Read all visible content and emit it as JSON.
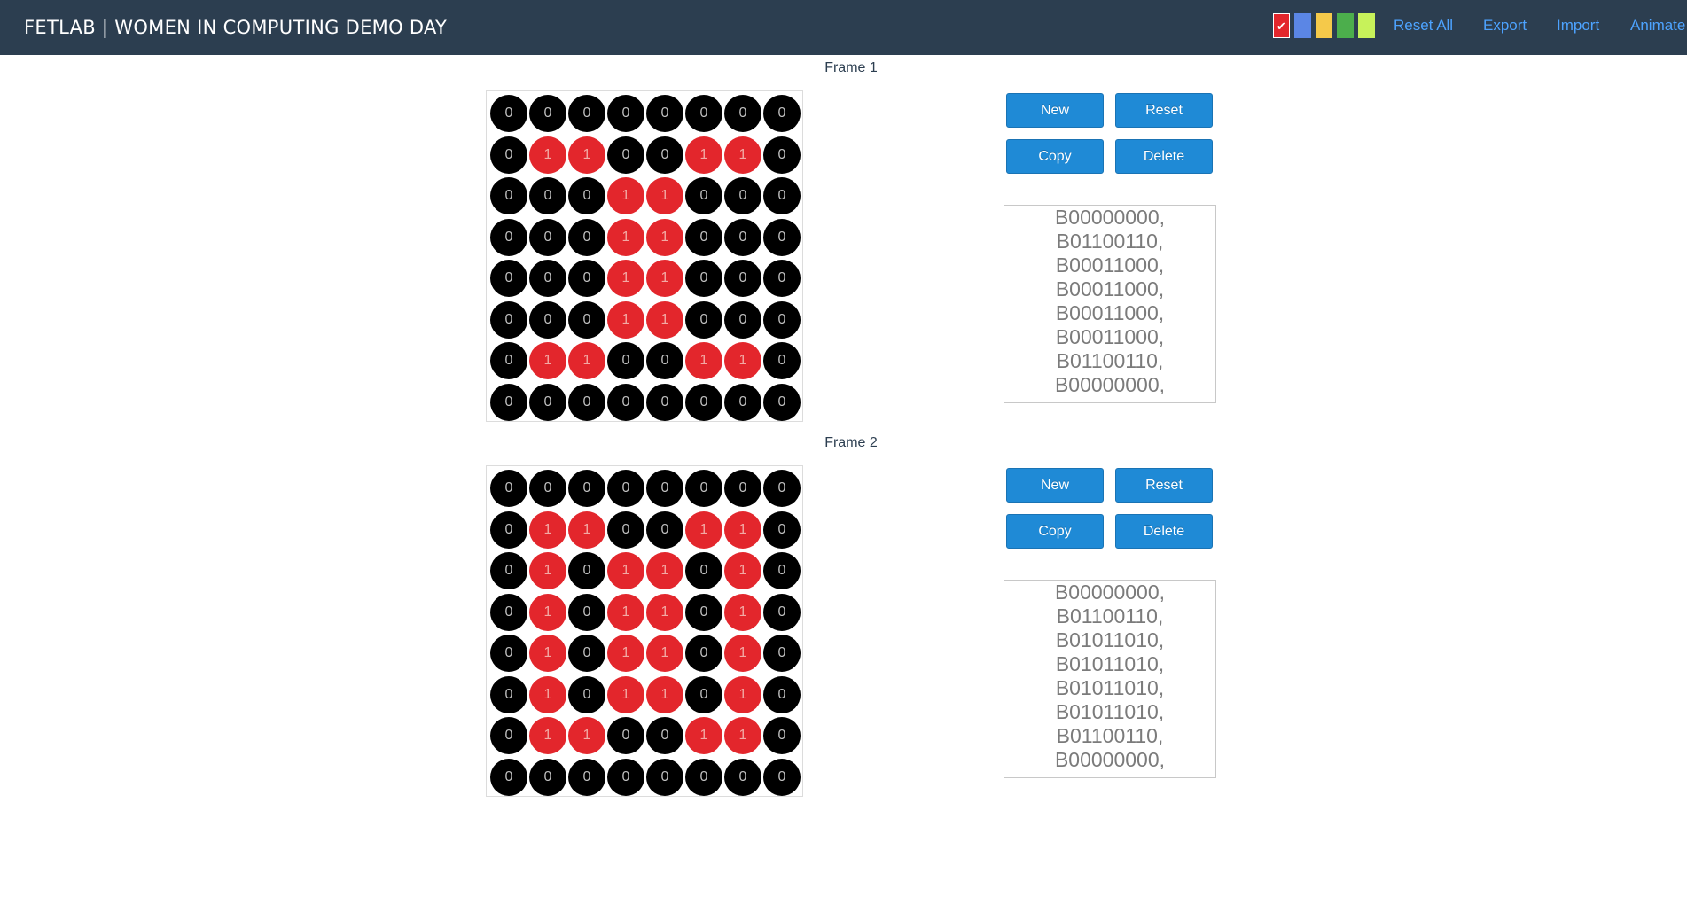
{
  "navbar": {
    "brand": "FETLAB | WOMEN IN COMPUTING DEMO DAY",
    "colors": [
      {
        "name": "red",
        "hex": "#e3262c",
        "selected": true,
        "check": "✔"
      },
      {
        "name": "blue",
        "hex": "#5b86e5",
        "selected": false,
        "check": ""
      },
      {
        "name": "yellow",
        "hex": "#f5c94a",
        "selected": false,
        "check": ""
      },
      {
        "name": "green",
        "hex": "#4cae4c",
        "selected": false,
        "check": ""
      },
      {
        "name": "lime",
        "hex": "#c7f25a",
        "selected": false,
        "check": ""
      }
    ],
    "links": [
      "Reset All",
      "Export",
      "Import",
      "Animate"
    ]
  },
  "frames": [
    {
      "label": "Frame 1",
      "buttons": {
        "new": "New",
        "reset": "Reset",
        "copy": "Copy",
        "delete": "Delete"
      },
      "rows": [
        "00000000",
        "01100110",
        "00011000",
        "00011000",
        "00011000",
        "00011000",
        "01100110",
        "00000000"
      ],
      "code": [
        "B00000000,",
        "B01100110,",
        "B00011000,",
        "B00011000,",
        "B00011000,",
        "B00011000,",
        "B01100110,",
        "B00000000,"
      ]
    },
    {
      "label": "Frame 2",
      "buttons": {
        "new": "New",
        "reset": "Reset",
        "copy": "Copy",
        "delete": "Delete"
      },
      "rows": [
        "00000000",
        "01100110",
        "01011010",
        "01011010",
        "01011010",
        "01011010",
        "01100110",
        "00000000"
      ],
      "code": [
        "B00000000,",
        "B01100110,",
        "B01011010,",
        "B01011010,",
        "B01011010,",
        "B01011010,",
        "B01100110,",
        "B00000000,"
      ]
    }
  ]
}
